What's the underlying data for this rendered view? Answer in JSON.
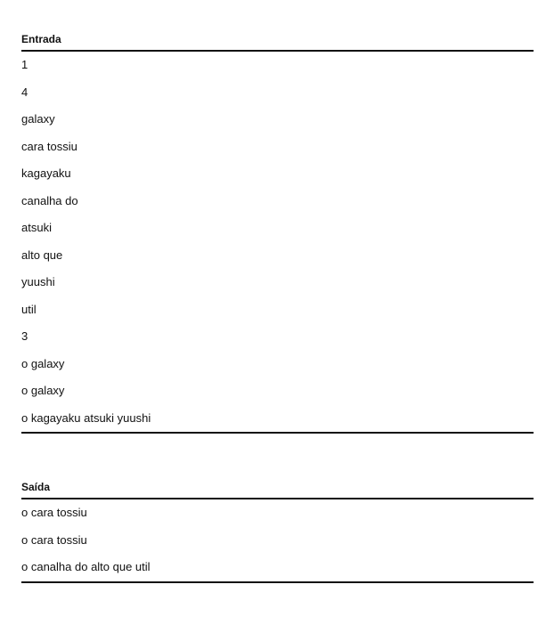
{
  "entrada": {
    "heading": "Entrada",
    "lines": [
      "1",
      "4",
      "galaxy",
      "cara tossiu",
      "kagayaku",
      "canalha do",
      "atsuki",
      "alto que",
      "yuushi",
      "util",
      "3",
      "o galaxy",
      "o galaxy",
      "o kagayaku atsuki yuushi"
    ]
  },
  "saida": {
    "heading": "Saída",
    "lines": [
      "o cara tossiu",
      "o cara tossiu",
      "o canalha do alto que util"
    ]
  }
}
